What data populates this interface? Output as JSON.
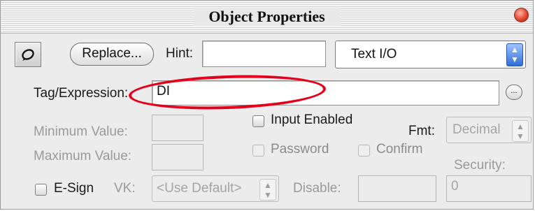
{
  "window": {
    "title": "Object Properties"
  },
  "toolbar": {
    "replace_label": "Replace...",
    "hint_label": "Hint:",
    "hint_value": "",
    "type_selected": "Text I/O"
  },
  "tag": {
    "label": "Tag/Expression:",
    "value": "DI",
    "browse_label": "..."
  },
  "min": {
    "label": "Minimum Value:",
    "value": ""
  },
  "max": {
    "label": "Maximum Value:",
    "value": ""
  },
  "options": {
    "input_enabled": "Input Enabled",
    "password": "Password",
    "confirm": "Confirm"
  },
  "fmt": {
    "label": "Fmt:",
    "selected": "Decimal"
  },
  "security": {
    "label": "Security:",
    "value": "0"
  },
  "esign": {
    "label": "E-Sign"
  },
  "vk": {
    "label": "VK:",
    "selected": "<Use Default>"
  },
  "disable": {
    "label": "Disable:",
    "value": ""
  },
  "colors": {
    "annotation": "#e4001b",
    "accent": "#2f6fd6"
  },
  "icons": {
    "object": "object-icon",
    "browse": "ellipsis-icon",
    "close": "close-icon"
  }
}
